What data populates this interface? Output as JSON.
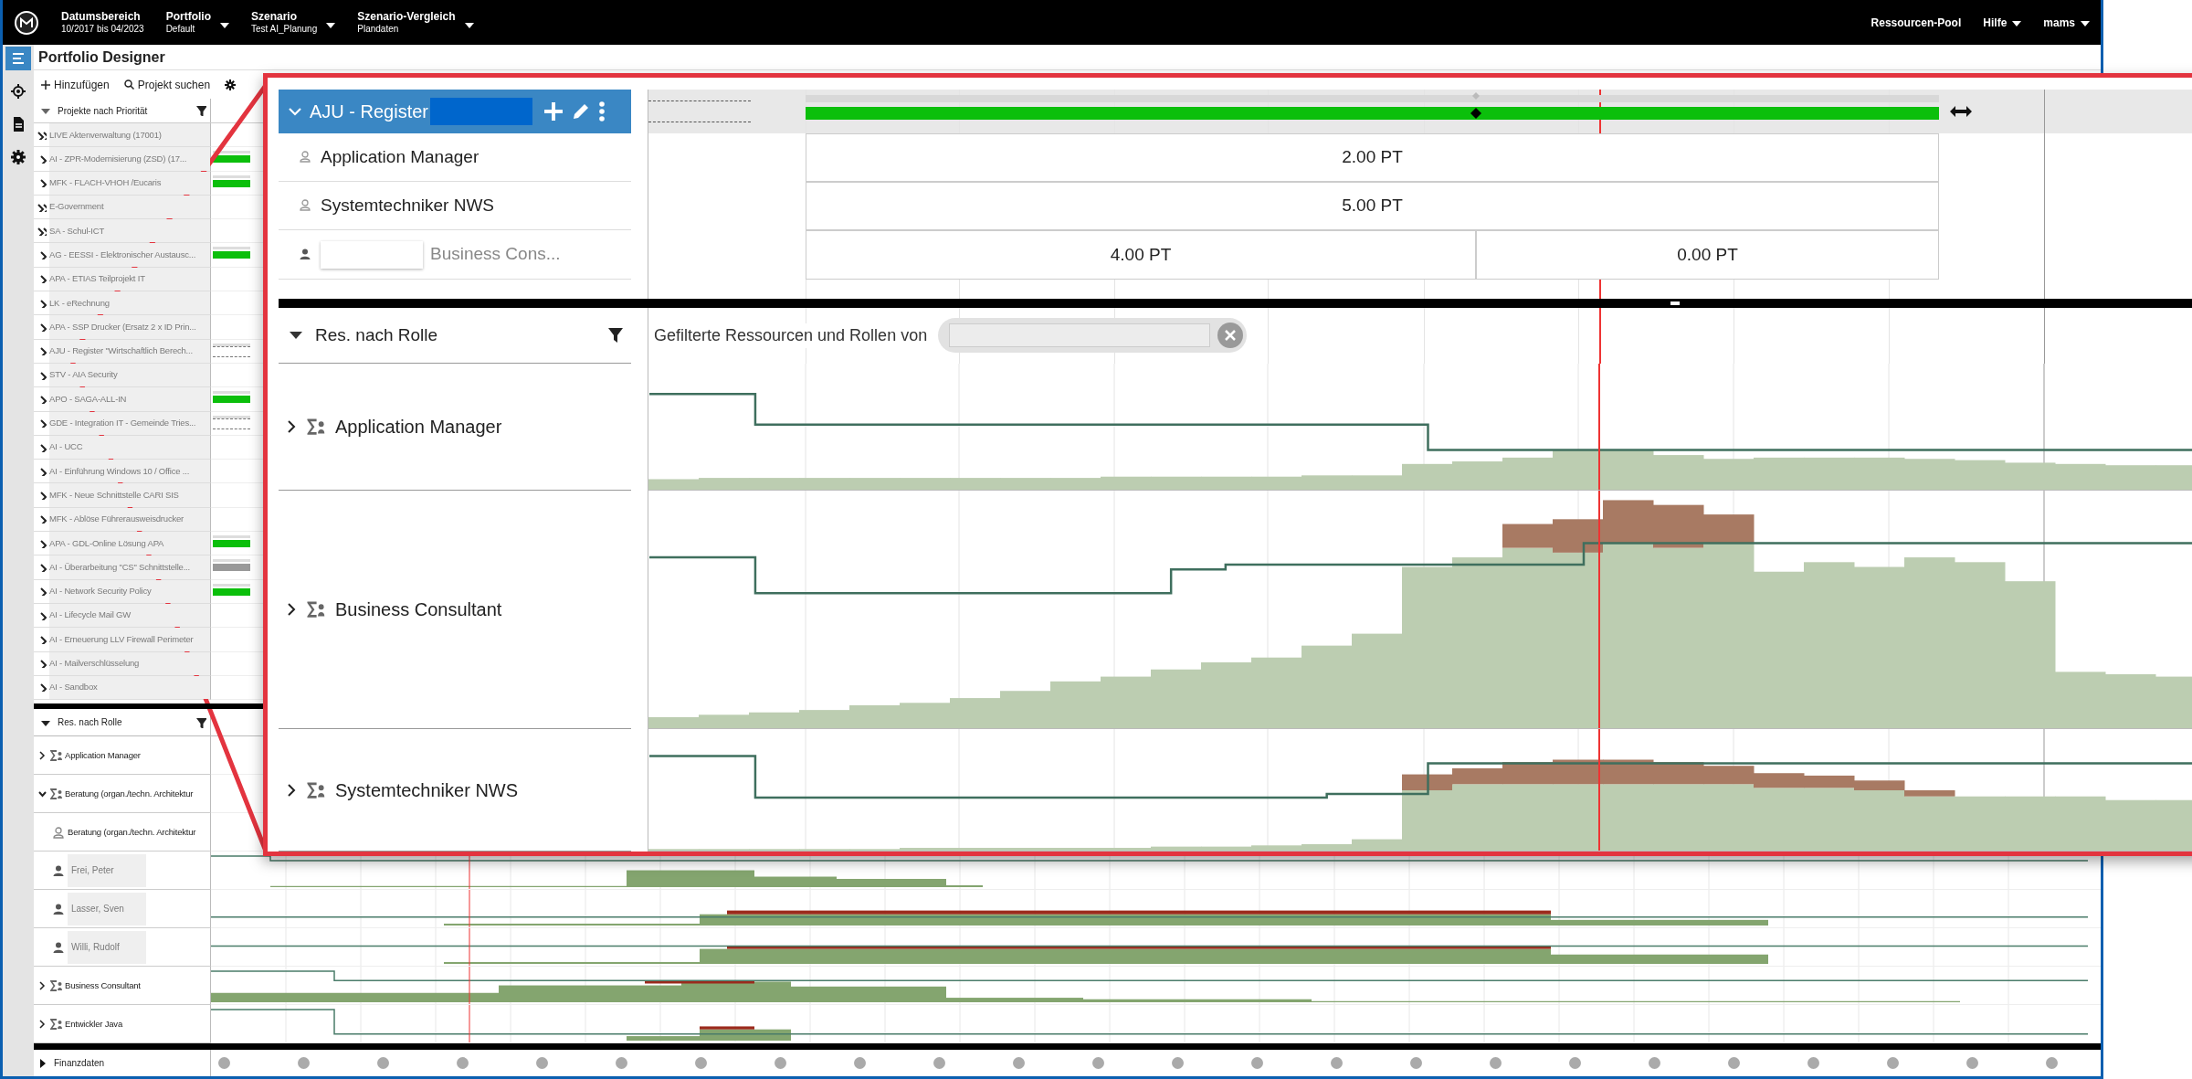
{
  "top_bar": {
    "menus": [
      {
        "label": "Datumsbereich",
        "value": "10/2017 bis 04/2023",
        "dropdown": false
      },
      {
        "label": "Portfolio",
        "value": "Default",
        "dropdown": true
      },
      {
        "label": "Szenario",
        "value": "Test AI_Planung",
        "dropdown": true
      },
      {
        "label": "Szenario-Vergleich",
        "value": "Plandaten",
        "dropdown": true
      }
    ],
    "right_menus": [
      {
        "label": "Ressourcen-Pool",
        "dropdown": false
      },
      {
        "label": "Hilfe",
        "dropdown": true
      },
      {
        "label": "mams",
        "dropdown": true
      }
    ]
  },
  "side_nav": [
    {
      "kind": "menu",
      "selected": true
    },
    {
      "kind": "target",
      "selected": false
    },
    {
      "kind": "document",
      "selected": false
    },
    {
      "kind": "settings",
      "selected": false
    }
  ],
  "page_title": "Portfolio Designer",
  "toolbar": [
    {
      "kind": "add",
      "label": "Hinzufügen"
    },
    {
      "kind": "search",
      "label": "Projekt suchen"
    },
    {
      "kind": "settings"
    }
  ],
  "projects": {
    "header": "Projekte nach Priorität",
    "rows": [
      {
        "kind": "group",
        "name": "LIVE Aktenverwaltung (17001)"
      },
      {
        "kind": "project",
        "name": "AI - ZPR-Modernisierung (ZSD) (17...",
        "bar": {
          "kind": "active"
        }
      },
      {
        "kind": "project",
        "name": "MFK - FLACH-VHOH /Eucaris",
        "bar": {
          "kind": "active"
        }
      },
      {
        "kind": "group",
        "name": "E-Government"
      },
      {
        "kind": "group",
        "name": "SA - Schul-ICT"
      },
      {
        "kind": "project",
        "name": "AG - EESSI - Elektronischer Austausc...",
        "bar": {
          "kind": "active"
        }
      },
      {
        "kind": "project",
        "name": "APA - ETIAS Teilprojekt IT"
      },
      {
        "kind": "project",
        "name": "LK - eRechnung"
      },
      {
        "kind": "project",
        "name": "APA - SSP Drucker (Ersatz 2 x ID Prin..."
      },
      {
        "kind": "project",
        "name": "AJU - Register \"Wirtschaftlich Berech...",
        "bar": {
          "kind": "planned"
        }
      },
      {
        "kind": "project",
        "name": "STV - AIA Security"
      },
      {
        "kind": "project",
        "name": "APO - SAGA-ALL-IN",
        "bar": {
          "kind": "active"
        }
      },
      {
        "kind": "project",
        "name": "GDE - Integration IT - Gemeinde Tries...",
        "bar": {
          "kind": "planned"
        }
      },
      {
        "kind": "project",
        "name": "AI - UCC"
      },
      {
        "kind": "project",
        "name": "AI - Einführung Windows 10 / Office ..."
      },
      {
        "kind": "project",
        "name": "MFK - Neue Schnittstelle CARI SIS"
      },
      {
        "kind": "project",
        "name": "MFK - Ablöse Führerausweisdrucker"
      },
      {
        "kind": "project",
        "name": "APA - GDL-Online Lösung APA",
        "bar": {
          "kind": "active"
        }
      },
      {
        "kind": "project",
        "name": "AI - Überarbeitung \"CS\" Schnittstelle...",
        "bar": {
          "kind": "inactive"
        }
      },
      {
        "kind": "project",
        "name": "AI - Network Security Policy",
        "bar": {
          "kind": "active"
        }
      },
      {
        "kind": "project",
        "name": "AI - Lifecycle Mail GW"
      },
      {
        "kind": "project",
        "name": "AI - Erneuerung LLV Firewall Perimeter"
      },
      {
        "kind": "project",
        "name": "AI - Mailverschlüsselung"
      },
      {
        "kind": "project",
        "name": "AI - Sandbox"
      }
    ]
  },
  "resources": {
    "header": "Res. nach Rolle",
    "rows": [
      {
        "kind": "role",
        "name": "Application Manager",
        "expanded": false
      },
      {
        "kind": "role",
        "name": "Beratung (organ./techn. Architektur",
        "expanded": true,
        "children": [
          {
            "kind": "role_assignment",
            "name": "Beratung (organ./techn. Architektur"
          },
          {
            "kind": "person",
            "name": "Frei, Peter"
          },
          {
            "kind": "person",
            "name": "Lasser, Sven"
          },
          {
            "kind": "person",
            "name": "Willi, Rudolf"
          }
        ]
      },
      {
        "kind": "role",
        "name": "Business Consultant",
        "expanded": false
      },
      {
        "kind": "role",
        "name": "Entwickler Java",
        "expanded": false
      }
    ]
  },
  "finance": {
    "label": "Finanzdaten",
    "expanded": false
  },
  "callout": {
    "project": {
      "name": "AJU - Register",
      "expanded": true
    },
    "assignments": [
      {
        "kind": "role",
        "name": "Application Manager",
        "cells": [
          "2.00 PT"
        ]
      },
      {
        "kind": "role",
        "name": "Systemtechniker NWS",
        "cells": [
          "5.00 PT"
        ]
      },
      {
        "kind": "person",
        "name": "Business Cons...",
        "cells": [
          "4.00 PT",
          "0.00 PT"
        ]
      }
    ],
    "resources": {
      "header": "Res. nach Rolle",
      "filter_label": "Gefilterte Ressourcen und Rollen von",
      "rows": [
        {
          "name": "Application Manager",
          "expanded": false
        },
        {
          "name": "Business Consultant",
          "expanded": false
        },
        {
          "name": "Systemtechniker NWS",
          "expanded": false
        }
      ]
    }
  }
}
